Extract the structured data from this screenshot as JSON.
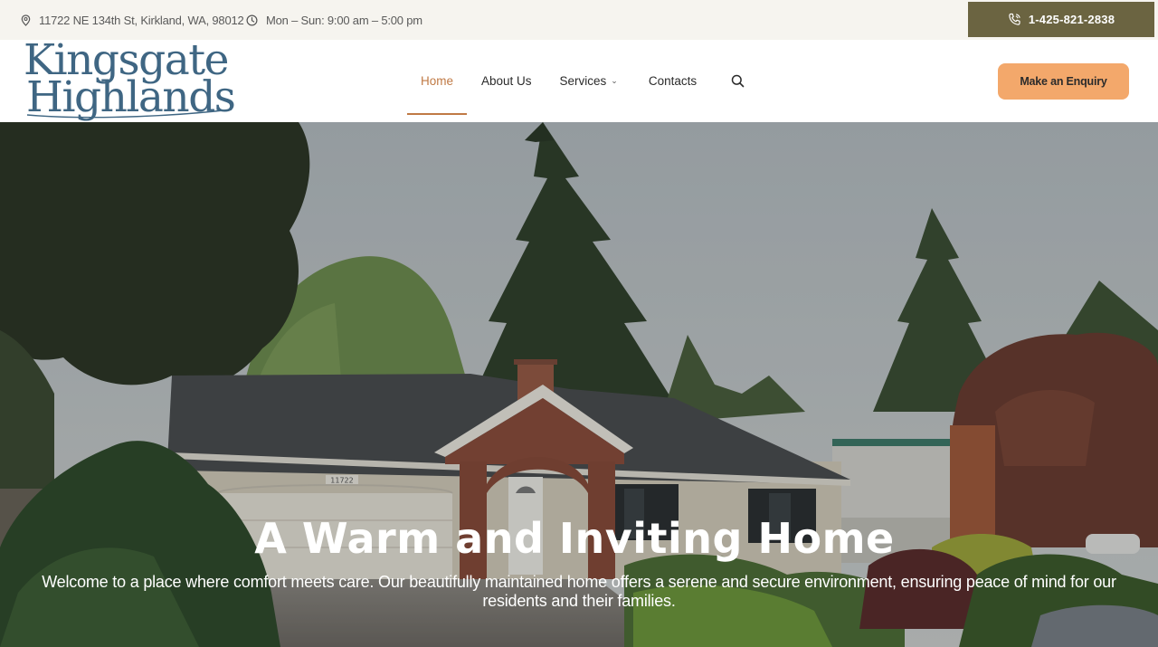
{
  "topbar": {
    "address": "11722 NE 134th St, Kirkland, WA, 98012",
    "address_icon": "map-pin-icon",
    "hours": "Mon – Sun: 9:00 am – 5:00 pm",
    "hours_icon": "clock-icon",
    "phone": "1-425-821-2838",
    "phone_icon": "phone-icon",
    "phone_bg": "#6b6441"
  },
  "logo": {
    "line1": "Kingsgate",
    "line2": "Highlands",
    "color": "#3f6683"
  },
  "nav": {
    "items": [
      {
        "label": "Home",
        "active": true
      },
      {
        "label": "About Us",
        "active": false
      },
      {
        "label": "Services",
        "active": false,
        "has_dropdown": true
      },
      {
        "label": "Contacts",
        "active": false
      }
    ],
    "search_icon": "search-icon",
    "active_color": "#c07a45"
  },
  "cta": {
    "label": "Make an Enquiry",
    "color": "#f3a86b"
  },
  "hero": {
    "title": "A Warm and Inviting Home",
    "subtitle": "Welcome to a place where comfort meets care. Our beautifully maintained home offers a serene and secure environment, ensuring peace of mind for our residents and their families.",
    "house_number": "11722"
  }
}
